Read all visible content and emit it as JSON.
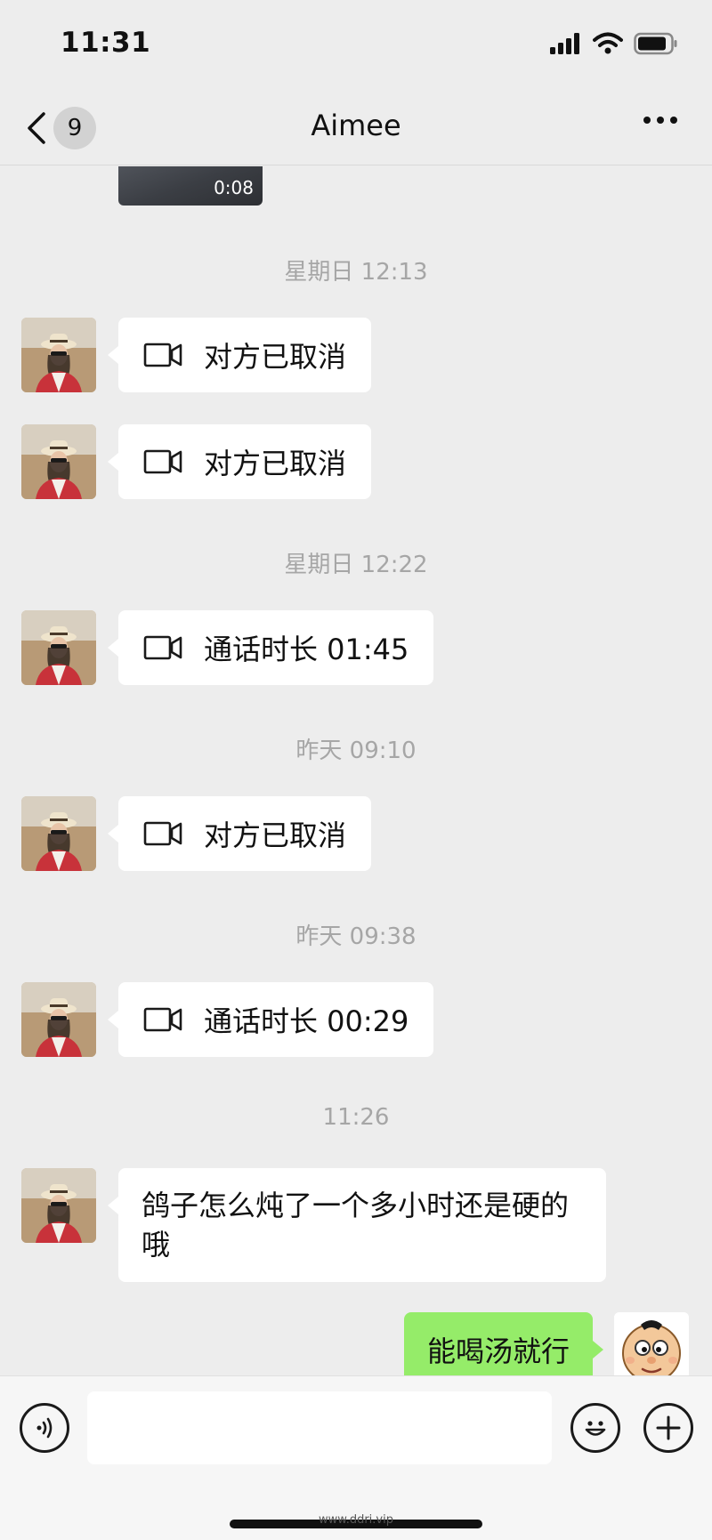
{
  "status_bar": {
    "time": "11:31"
  },
  "nav": {
    "unread_count": "9",
    "title": "Aimee"
  },
  "video_message": {
    "duration": "0:08"
  },
  "messages": [
    {
      "timestamp": "星期日 12:13"
    },
    {
      "call_label": "对方已取消"
    },
    {
      "call_label": "对方已取消"
    },
    {
      "timestamp": "星期日 12:22"
    },
    {
      "call_label": "通话时长 01:45"
    },
    {
      "timestamp": "昨天 09:10"
    },
    {
      "call_label": "对方已取消"
    },
    {
      "timestamp": "昨天 09:38"
    },
    {
      "call_label": "通话时长 00:29"
    },
    {
      "timestamp": "11:26"
    },
    {
      "text": "鸽子怎么炖了一个多小时还是硬的哦"
    },
    {
      "my_text": "能喝汤就行"
    }
  ],
  "footer": {
    "watermark": "www.ddri.vip"
  },
  "colors": {
    "background": "#ededed",
    "my_bubble": "#95ec69",
    "their_bubble": "#ffffff"
  }
}
